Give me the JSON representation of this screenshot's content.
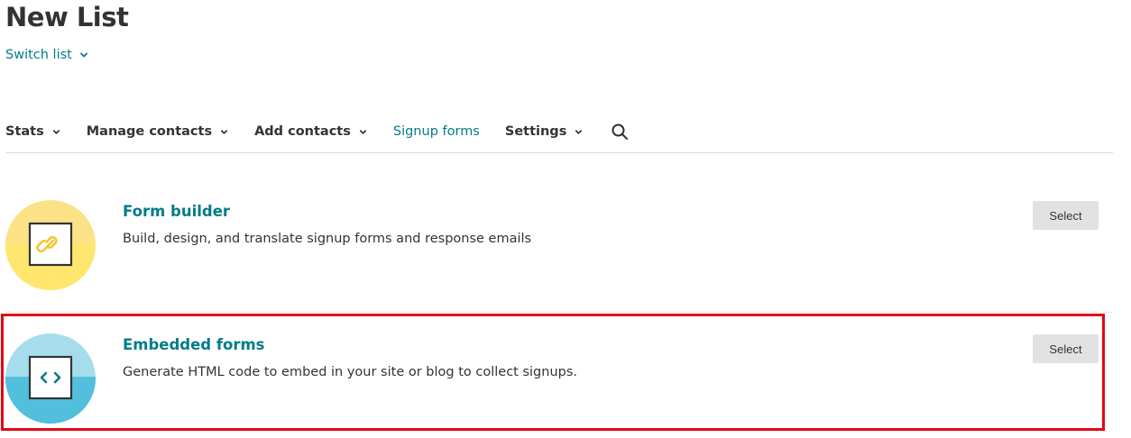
{
  "page": {
    "title": "New List"
  },
  "switch_list": {
    "label": "Switch list",
    "icon": "chevron-down-icon"
  },
  "nav": {
    "items": [
      {
        "label": "Stats",
        "has_dropdown": true,
        "active": false
      },
      {
        "label": "Manage contacts",
        "has_dropdown": true,
        "active": false
      },
      {
        "label": "Add contacts",
        "has_dropdown": true,
        "active": false
      },
      {
        "label": "Signup forms",
        "has_dropdown": false,
        "active": true
      },
      {
        "label": "Settings",
        "has_dropdown": true,
        "active": false
      }
    ],
    "search_icon": "search-icon"
  },
  "options": [
    {
      "title": "Form builder",
      "description": "Build, design, and translate signup forms and response emails",
      "button_label": "Select",
      "icon": "link-icon",
      "icon_bg": "#fbe287",
      "icon_bg_dark": "#ffe66e",
      "icon_fg": "#f5c530"
    },
    {
      "title": "Embedded forms",
      "description": "Generate HTML code to embed in your site or blog to collect signups.",
      "button_label": "Select",
      "icon": "code-icon",
      "icon_bg": "#a6dded",
      "icon_bg_dark": "#52bfdc",
      "icon_fg": "#007c89"
    }
  ],
  "colors": {
    "accent": "#007c89",
    "highlight_border": "#e30613",
    "button_bg": "#e2e2e2"
  }
}
